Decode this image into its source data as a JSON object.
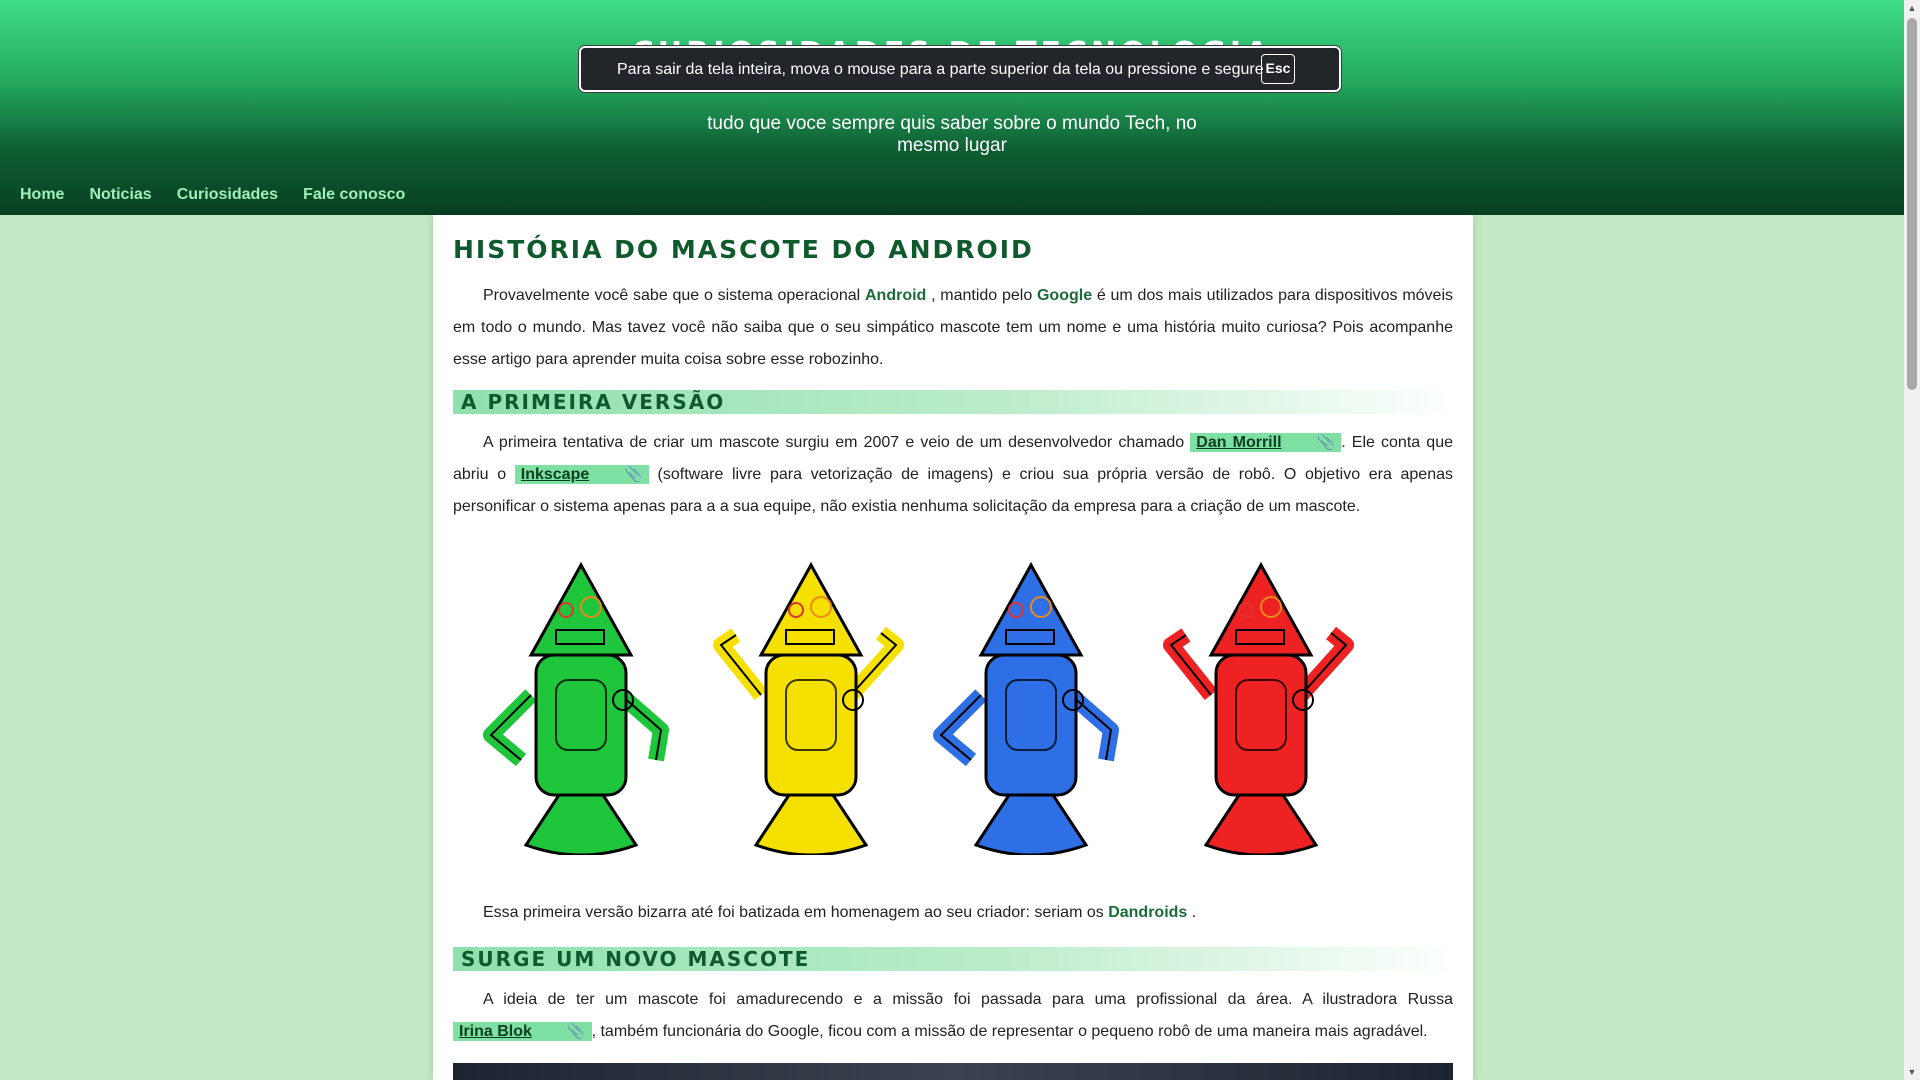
{
  "header": {
    "title": "Curiosidades de Tecnologia",
    "subtitle": "tudo que voce sempre quis saber sobre o mundo Tech, no mesmo lugar"
  },
  "nav": [
    {
      "label": "Home"
    },
    {
      "label": "Noticias"
    },
    {
      "label": "Curiosidades"
    },
    {
      "label": "Fale conosco"
    }
  ],
  "fullscreen_notice": {
    "message": "Para sair da tela inteira, mova o mouse para a parte superior da tela ou pressione e segure",
    "key": "Esc"
  },
  "article": {
    "title": "História do mascote do Android",
    "intro": {
      "t1": "Provavelmente você sabe que o sistema operacional ",
      "android": "Android",
      "t2": " , mantido pelo ",
      "google": "Google",
      "t3": " é um dos mais utilizados para dispositivos móveis em todo o mundo. Mas tavez você não saiba que o seu simpático mascote tem um nome e uma história muito curiosa? Pois acompanhe esse artigo para aprender muita coisa sobre esse robozinho."
    },
    "section1": {
      "heading": "A primeira versão",
      "p1": {
        "t1": "A primeira tentativa de criar um mascote surgiu em 2007 e veio de um desenvolvedor chamado ",
        "link1": "Dan Morrill",
        "t2": ". Ele conta que abriu o ",
        "link2": "Inkscape",
        "t3": " (software livre para vetorização de imagens) e criou sua própria versão de robô. O objetivo era apenas personificar o sistema apenas para a a sua equipe, não existia nenhuma solicitação da empresa para a criação de um mascote."
      },
      "robot_colors": [
        "#1fc53a",
        "#f6e000",
        "#2f6fe6",
        "#ee2222"
      ],
      "p2": {
        "t1": "Essa primeira versão bizarra até foi batizada em homenagem ao seu criador: seriam os ",
        "dandroids": "Dandroids",
        "t2": " ."
      }
    },
    "section2": {
      "heading": "Surge um novo mascote",
      "p1": {
        "t1": "A ideia de ter um mascote foi amadurecendo e a missão foi passada para uma profissional da área. A ilustradora Russa ",
        "link": "Irina Blok",
        "t2": ", também funcionária do Google, ficou com a missão de representar o pequeno robô de uma maneira mais agradável."
      }
    },
    "link_icon": "paperclip-link-icon"
  },
  "colors": {
    "header_top": "#3fdc86",
    "header_bottom": "#083f22",
    "page_bg": "#c4e9c5",
    "accent_text": "#0f5a2c",
    "chip_bg": "#7ee0a3"
  }
}
